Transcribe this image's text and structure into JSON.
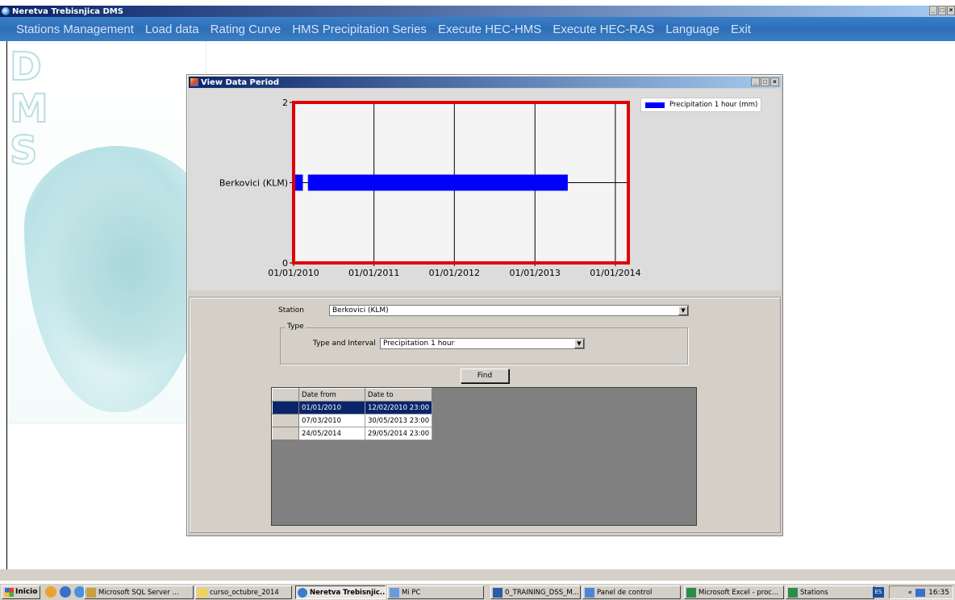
{
  "app": {
    "title": "Neretva Trebisnjica DMS",
    "window_controls": [
      "_",
      "□",
      "×"
    ]
  },
  "menu": [
    "Stations Management",
    "Load data",
    "Rating Curve",
    "HMS Precipitation Series",
    "Execute HEC-HMS",
    "Execute HEC-RAS",
    "Language",
    "Exit"
  ],
  "logo_letters": [
    "D",
    "M",
    "S"
  ],
  "dialog": {
    "title": "View Data Period",
    "station_label": "Station",
    "station_value": "Berkovici (KLM)",
    "type_group_label": "Type",
    "type_interval_label": "Type and Interval",
    "type_interval_value": "Precipitation 1 hour",
    "find_label": "Find",
    "grid": {
      "headers": [
        "Date from",
        "Date to"
      ],
      "rows": [
        [
          "01/01/2010",
          "12/02/2010 23:00"
        ],
        [
          "07/03/2010",
          "30/05/2013 23:00"
        ],
        [
          "24/05/2014",
          "29/05/2014 23:00"
        ]
      ],
      "selected_row": 0
    }
  },
  "chart_data": {
    "type": "bar",
    "orientation": "horizontal",
    "y_categories": [
      "Berkovici (KLM)"
    ],
    "y_ticks": [
      "2",
      "Berkovici (KLM)",
      "0"
    ],
    "x_ticks": [
      "01/01/2010",
      "01/01/2011",
      "01/01/2012",
      "01/01/2013",
      "01/01/2014"
    ],
    "xlim": [
      "2010-01-01",
      "2014-03-01"
    ],
    "series": [
      {
        "name": "Precipitation 1 hour (mm)",
        "color": "#0000ff",
        "intervals": [
          {
            "from": "2010-01-01",
            "to": "2010-02-12"
          },
          {
            "from": "2010-03-07",
            "to": "2013-05-30"
          }
        ]
      }
    ],
    "plot_border_color": "#e00000",
    "grid": true,
    "legend": "top-right"
  },
  "taskbar": {
    "start_label": "Inicio",
    "tasks": [
      {
        "label": "Microsoft SQL Server ...",
        "active": false
      },
      {
        "label": "curso_octubre_2014",
        "active": false
      },
      {
        "label": "Neretva Trebisnjic...",
        "active": true
      },
      {
        "label": "Mi PC",
        "active": false
      },
      {
        "label": "0_TRAINING_DSS_M...",
        "active": false
      },
      {
        "label": "Panel de control",
        "active": false
      },
      {
        "label": "Microsoft Excel - proc...",
        "active": false
      },
      {
        "label": "Stations",
        "active": false
      }
    ],
    "lang": "ES",
    "tray_arrows": "«",
    "time": "16:35"
  }
}
